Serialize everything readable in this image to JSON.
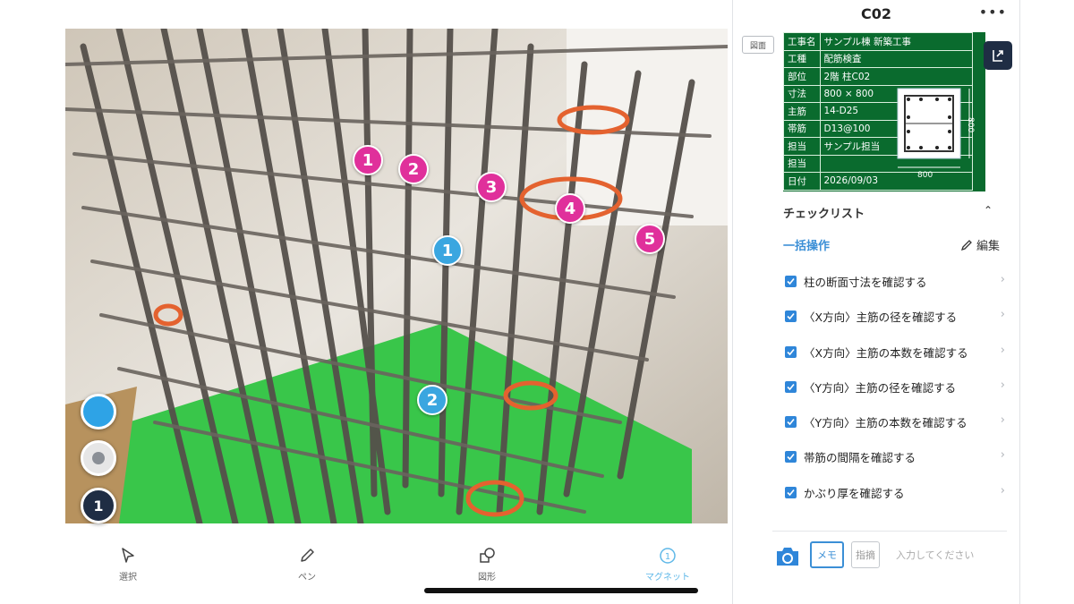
{
  "markers_pink": [
    "1",
    "2",
    "3",
    "4",
    "5"
  ],
  "markers_blue": [
    "1",
    "2"
  ],
  "controls": {
    "layer_number": "1"
  },
  "toolbar": {
    "select": "選択",
    "pen": "ペン",
    "shape": "図形",
    "magnet": "マグネット"
  },
  "panel": {
    "title": "C02",
    "more": "•••",
    "drawing_button": "図面",
    "board": {
      "rows": [
        {
          "k": "工事名",
          "v": "サンプル棟 新築工事"
        },
        {
          "k": "工種",
          "v": "配筋検査"
        },
        {
          "k": "部位",
          "v": "2階 柱C02"
        },
        {
          "k": "寸法",
          "v": "800 × 800"
        },
        {
          "k": "主筋",
          "v": "14-D25"
        },
        {
          "k": "帯筋",
          "v": "D13@100"
        },
        {
          "k": "担当",
          "v": "サンプル担当"
        },
        {
          "k": "担当",
          "v": ""
        },
        {
          "k": "日付",
          "v": "2026/09/03"
        }
      ],
      "sketch_width": "800",
      "sketch_height": "800"
    },
    "checklist": {
      "title": "チェックリスト",
      "bulk": "一括操作",
      "edit": "編集",
      "items": [
        "柱の断面寸法を確認する",
        "〈X方向〉主筋の径を確認する",
        "〈X方向〉主筋の本数を確認する",
        "〈Y方向〉主筋の径を確認する",
        "〈Y方向〉主筋の本数を確認する",
        "帯筋の間隔を確認する",
        "かぶり厚を確認する"
      ]
    },
    "memo": {
      "memo_chip": "メモ",
      "note_chip": "指摘",
      "placeholder": "入力してください"
    }
  },
  "colors": {
    "accent": "#3b8fd6",
    "pink_marker": "#e0309b",
    "blue_marker": "#3aa6e0",
    "board_green": "#0a6b2e",
    "dark_navy": "#1f2d44"
  }
}
